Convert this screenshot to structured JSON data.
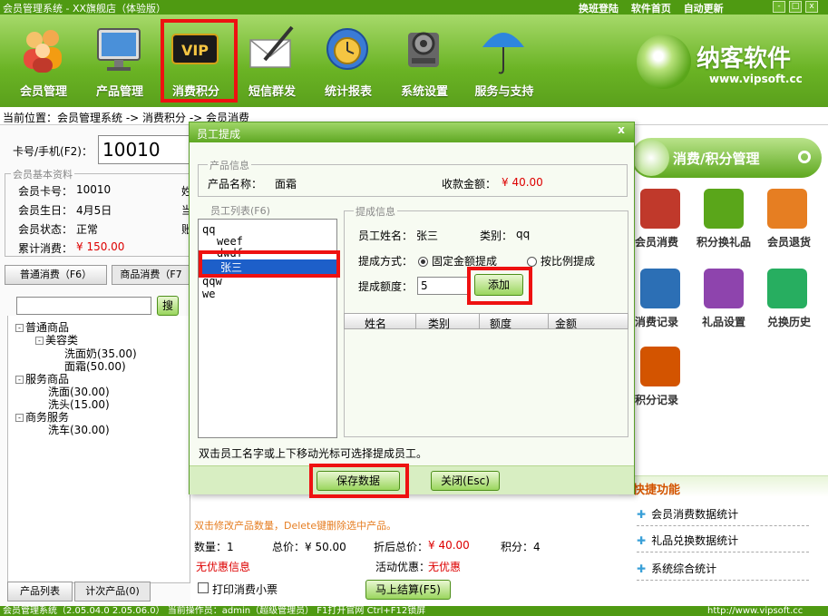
{
  "window": {
    "title": "会员管理系统 - XX旗舰店（体验版）",
    "top_links": [
      "换班登陆",
      "软件首页",
      "自动更新"
    ],
    "controls": [
      "-",
      "□",
      "x"
    ]
  },
  "toolbar": {
    "items": [
      {
        "label": "会员管理",
        "icon": "members-icon"
      },
      {
        "label": "产品管理",
        "icon": "monitor-icon"
      },
      {
        "label": "消费积分",
        "icon": "vip-card-icon"
      },
      {
        "label": "短信群发",
        "icon": "envelope-icon"
      },
      {
        "label": "统计报表",
        "icon": "clock-globe-icon"
      },
      {
        "label": "系统设置",
        "icon": "gear-icon"
      },
      {
        "label": "服务与支持",
        "icon": "umbrella-icon"
      }
    ],
    "vip_text": "VIP",
    "brand_name": "纳客软件",
    "brand_url": "www.vipsoft.cc"
  },
  "breadcrumb": "当前位置：会员管理系统 -> 消费积分 -> 会员消费",
  "left": {
    "card_label": "卡号/手机(F2)：",
    "card_value": "10010",
    "basic_legend": "会员基本资料",
    "fields": [
      {
        "label": "会员卡号：",
        "value": "10010"
      },
      {
        "label": "会员生日：",
        "value": "4月5日"
      },
      {
        "label": "会员状态：",
        "value": "正常"
      },
      {
        "label": "累计消费：",
        "value": "¥ 150.00"
      }
    ],
    "side_chars": [
      "姓",
      "当",
      "账"
    ],
    "tabs": [
      "普通消费（F6）",
      "商品消费（F7"
    ],
    "search_button": "搜",
    "tree": [
      {
        "label": "普通商品",
        "level": 0,
        "box": "-"
      },
      {
        "label": "美容类",
        "level": 1,
        "box": "-"
      },
      {
        "label": "洗面奶(35.00)",
        "level": 2
      },
      {
        "label": "面霜(50.00)",
        "level": 2
      },
      {
        "label": "服务商品",
        "level": 0,
        "box": "-"
      },
      {
        "label": "洗面(30.00)",
        "level": 1
      },
      {
        "label": "洗头(15.00)",
        "level": 1
      },
      {
        "label": "商务服务",
        "level": 0,
        "box": "-"
      },
      {
        "label": "洗车(30.00)",
        "level": 1
      }
    ],
    "bottom_tabs": [
      "产品列表",
      "计次产品(0)"
    ]
  },
  "right": {
    "header": "消费/积分管理",
    "items": [
      {
        "label": "会员消费",
        "icon": "card-payment-icon",
        "color": "#c0392b"
      },
      {
        "label": "积分换礼品",
        "icon": "gift-icon",
        "color": "#5aa61a"
      },
      {
        "label": "会员退货",
        "icon": "truck-icon",
        "color": "#e67e22"
      },
      {
        "label": "消费记录",
        "icon": "laptop-chart-icon",
        "color": "#2c6fb5"
      },
      {
        "label": "礼品设置",
        "icon": "molecule-icon",
        "color": "#8e44ad"
      },
      {
        "label": "兑换历史",
        "icon": "heart-bag-icon",
        "color": "#27ae60"
      },
      {
        "label": "积分记录",
        "icon": "computer-icon",
        "color": "#d35400"
      }
    ],
    "quick_title": "快捷功能",
    "quick_links": [
      "会员消费数据统计",
      "礼品兑换数据统计",
      "系统综合统计"
    ]
  },
  "bottom": {
    "hint": "双击修改产品数量，Delete键删除选中产品。",
    "qty": "数量：1",
    "total": "总价：¥ 50.00",
    "discount_label": "折后总价：",
    "discount_value": "¥ 40.00",
    "points": "积分：4",
    "no_promo": "无优惠信息",
    "activity_label": "活动优惠：",
    "activity_value": "无优惠",
    "print_label": "打印消费小票",
    "settle_button": "马上结算(F5)"
  },
  "status": {
    "left": "会员管理系统（2.05.04.0 2.05.06.0） 当前操作员：admin（超级管理员） F1打开官网 Ctrl+F12锁屏",
    "right": "http://www.vipsoft.cc"
  },
  "dialog": {
    "title": "员工提成",
    "close": "x",
    "product_legend": "产品信息",
    "product_name_label": "产品名称：",
    "product_name": "面霜",
    "amount_label": "收款金额：",
    "amount_value": "¥ 40.00",
    "emp_legend": "员工列表(F6)",
    "employees": [
      "qq",
      "weef",
      "dwdf",
      "张三",
      "qqw",
      "we"
    ],
    "commission_legend": "提成信息",
    "emp_name_label": "员工姓名：",
    "emp_name": "张三",
    "category_label": "类别：",
    "category_value": "qq",
    "method_label": "提成方式：",
    "method_fixed": "固定金额提成",
    "method_ratio": "按比例提成",
    "amount_field_label": "提成额度：",
    "amount_field_value": "5",
    "add_button": "添加",
    "grid_headers": [
      "姓名",
      "类别",
      "额度",
      "金额"
    ],
    "hint": "双击员工名字或上下移动光标可选择提成员工。",
    "save_button": "保存数据",
    "close_button": "关闭(Esc)"
  }
}
